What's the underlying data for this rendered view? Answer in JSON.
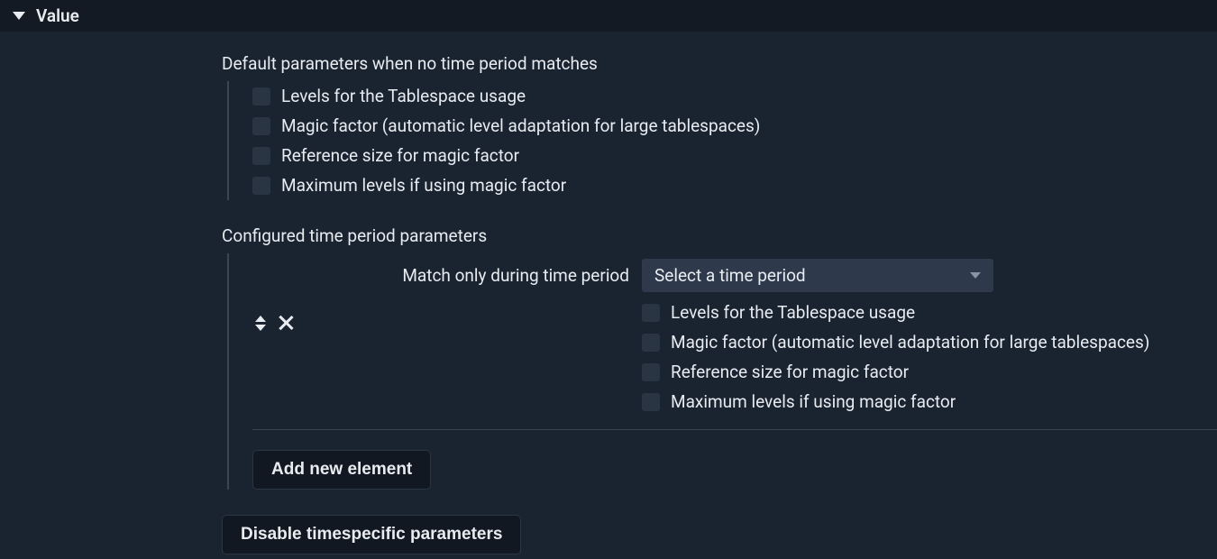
{
  "header": {
    "title": "Value"
  },
  "defaults": {
    "title": "Default parameters when no time period matches",
    "options": [
      "Levels for the Tablespace usage",
      "Magic factor (automatic level adaptation for large tablespaces)",
      "Reference size for magic factor",
      "Maximum levels if using magic factor"
    ]
  },
  "timeperiod": {
    "title": "Configured time period parameters",
    "match_label": "Match only during time period",
    "select_placeholder": "Select a time period",
    "options": [
      "Levels for the Tablespace usage",
      "Magic factor (automatic level adaptation for large tablespaces)",
      "Reference size for magic factor",
      "Maximum levels if using magic factor"
    ]
  },
  "buttons": {
    "add": "Add new element",
    "disable": "Disable timespecific parameters"
  }
}
